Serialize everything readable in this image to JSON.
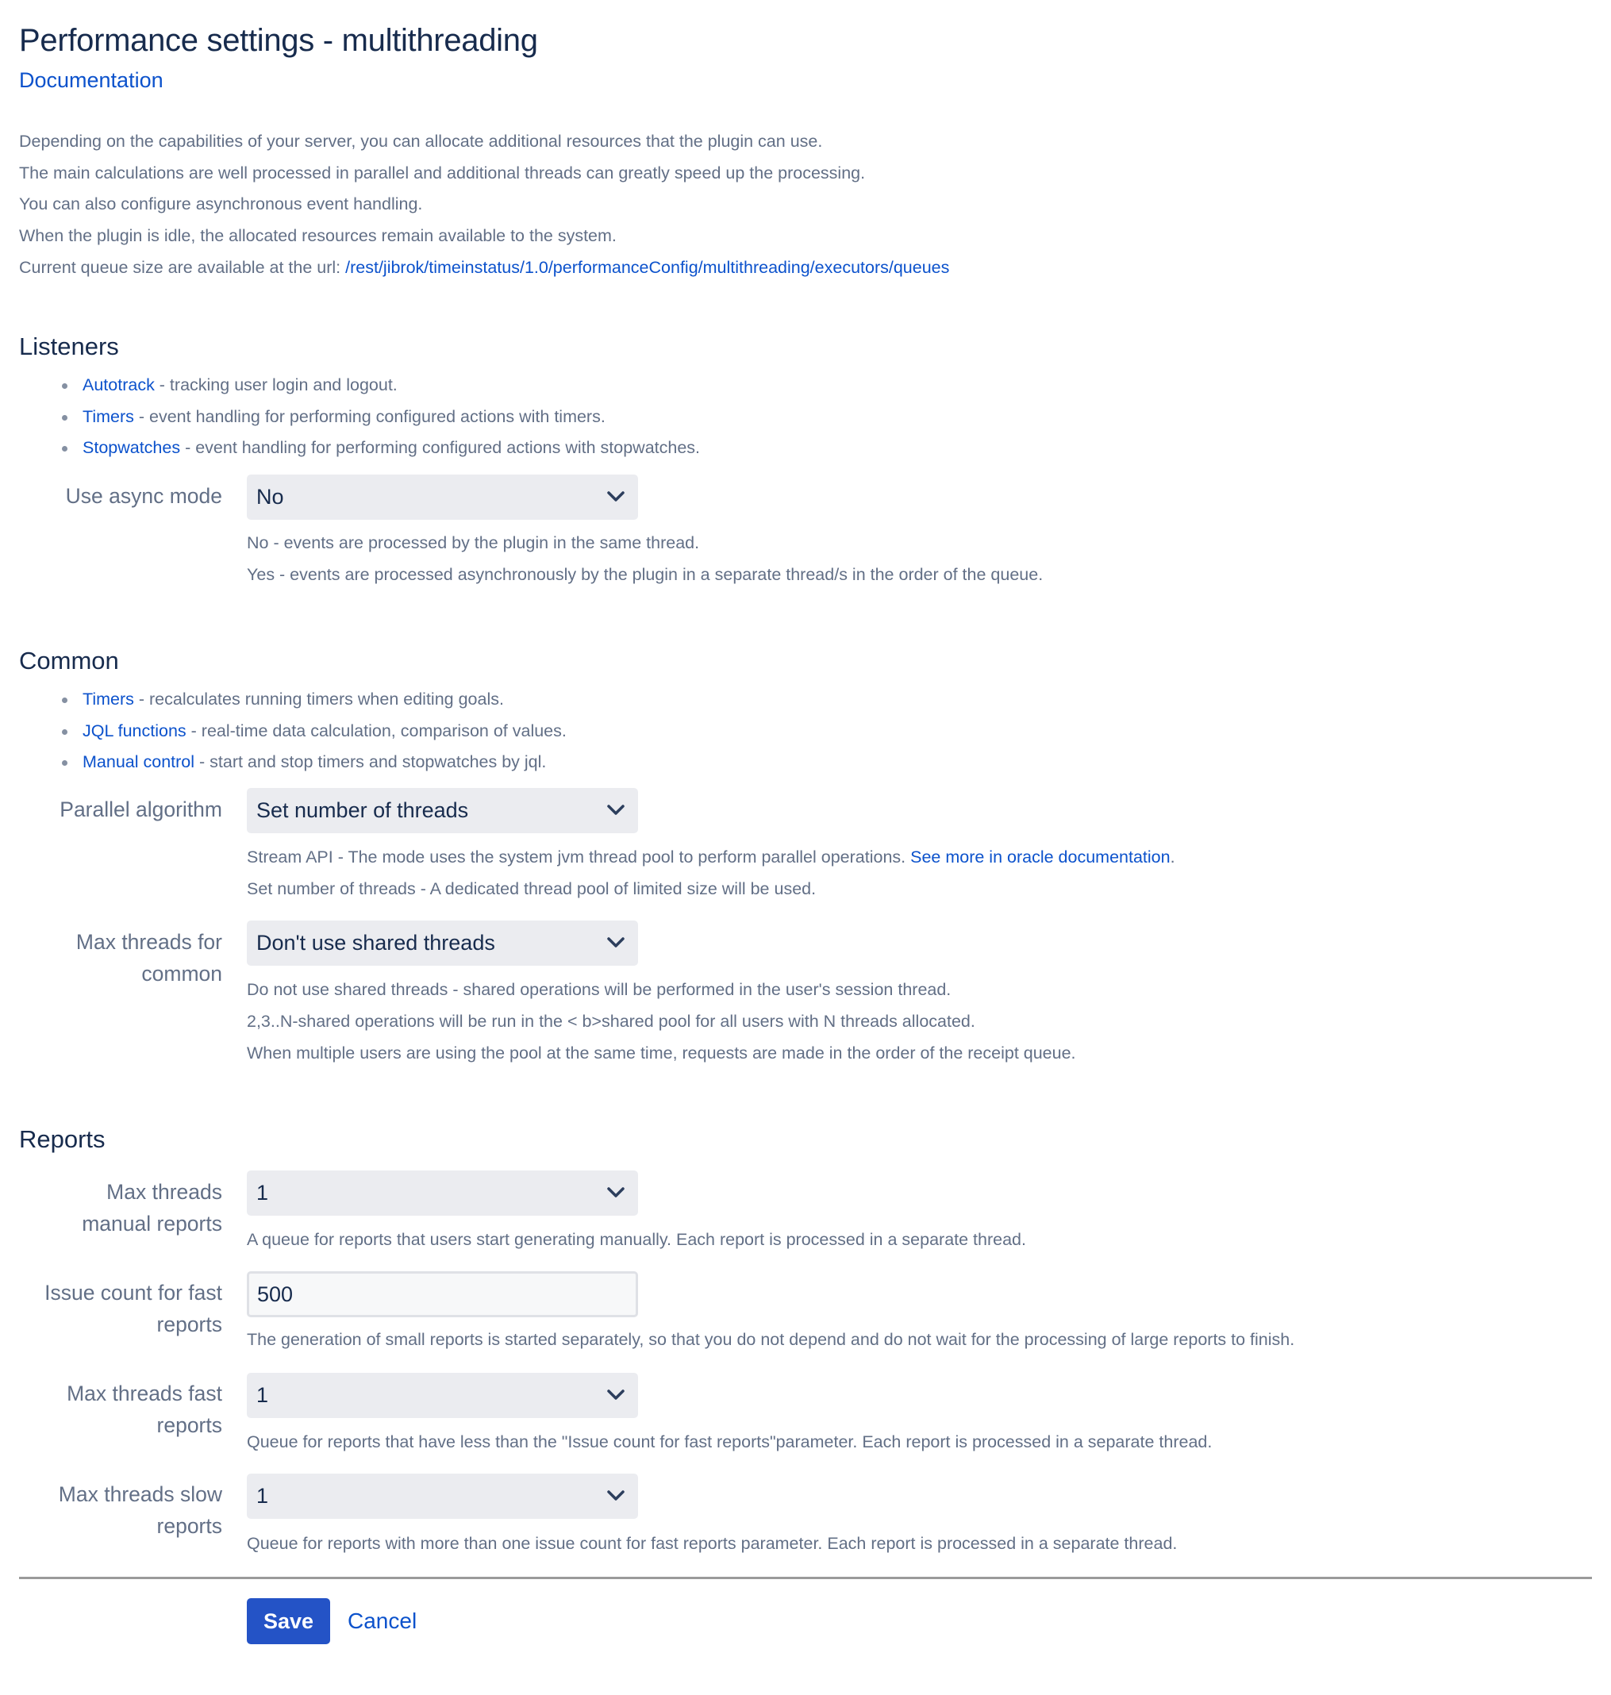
{
  "header": {
    "title": "Performance settings - multithreading",
    "doc_link": "Documentation"
  },
  "intro": {
    "lines": [
      "Depending on the capabilities of your server, you can allocate additional resources that the plugin can use.",
      "The main calculations are well processed in parallel and additional threads can greatly speed up the processing.",
      "You can also configure asynchronous event handling.",
      "When the plugin is idle, the allocated resources remain available to the system."
    ],
    "queue_prefix": "Current queue size are available at the url: ",
    "queue_url": "/rest/jibrok/timeinstatus/1.0/performanceConfig/multithreading/executors/queues"
  },
  "listeners": {
    "heading": "Listeners",
    "items": [
      {
        "link": "Autotrack",
        "text": " - tracking user login and logout."
      },
      {
        "link": "Timers",
        "text": " - event handling for performing configured actions with timers."
      },
      {
        "link": "Stopwatches",
        "text": " - event handling for performing configured actions with stopwatches."
      }
    ],
    "async": {
      "label": "Use async mode",
      "value": "No",
      "help": [
        "No - events are processed by the plugin in the same thread.",
        "Yes - events are processed asynchronously by the plugin in a separate thread/s in the order of the queue."
      ]
    }
  },
  "common": {
    "heading": "Common",
    "items": [
      {
        "link": "Timers",
        "text": " - recalculates running timers when editing goals."
      },
      {
        "link": "JQL functions",
        "text": " - real-time data calculation, comparison of values."
      },
      {
        "link": "Manual control",
        "text": " - start and stop timers and stopwatches by jql."
      }
    ],
    "parallel": {
      "label": "Parallel algorithm",
      "value": "Set number of threads",
      "help1_prefix": "Stream API - The mode uses the system jvm thread pool to perform parallel operations. ",
      "help1_link": "See more in oracle documentation",
      "help1_suffix": ".",
      "help2": "Set number of threads - A dedicated thread pool of limited size will be used."
    },
    "max_threads": {
      "label1": "Max threads for",
      "label2": "common",
      "value": "Don't use shared threads",
      "help": [
        "Do not use shared threads - shared operations will be performed in the user's session thread.",
        "2,3..N-shared operations will be run in the < b>shared pool for all users with N threads allocated.",
        "When multiple users are using the pool at the same time, requests are made in the order of the receipt queue."
      ]
    }
  },
  "reports": {
    "heading": "Reports",
    "manual": {
      "label1": "Max threads",
      "label2": "manual reports",
      "value": "1",
      "help": "A queue for reports that users start generating manually. Each report is processed in a separate thread."
    },
    "issue_count": {
      "label1": "Issue count for fast",
      "label2": "reports",
      "value": "500",
      "help": "The generation of small reports is started separately, so that you do not depend and do not wait for the processing of large reports to finish."
    },
    "fast": {
      "label1": "Max threads fast",
      "label2": "reports",
      "value": "1",
      "help": "Queue for reports that have less than the \"Issue count for fast reports\"parameter. Each report is processed in a separate thread."
    },
    "slow": {
      "label1": "Max threads slow",
      "label2": "reports",
      "value": "1",
      "help": "Queue for reports with more than one issue count for fast reports parameter. Each report is processed in a separate thread."
    }
  },
  "footer": {
    "save": "Save",
    "cancel": "Cancel"
  }
}
